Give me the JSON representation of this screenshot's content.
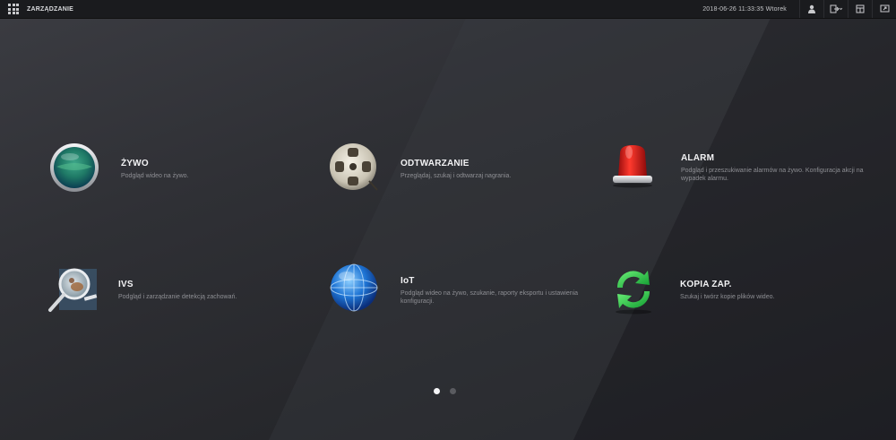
{
  "topbar": {
    "title": "ZARZĄDZANIE",
    "datetime": "2018-06-26 11:33:35 Wtorek",
    "icons": [
      "user-icon",
      "logout-icon",
      "window-icon",
      "fullscreen-icon"
    ]
  },
  "tiles": [
    {
      "title": "ŻYWO",
      "desc": "Podgląd wideo na żywo.",
      "icon": "live-view-icon"
    },
    {
      "title": "ODTWARZANIE",
      "desc": "Przeglądaj, szukaj i odtwarzaj nagrania.",
      "icon": "film-reel-icon"
    },
    {
      "title": "ALARM",
      "desc": "Podgląd i przeszukiwanie alarmów na żywo. Konfiguracja akcji na wypadek alarmu.",
      "icon": "alarm-siren-icon"
    },
    {
      "title": "IVS",
      "desc": "Podgląd i zarządzanie detekcją zachowań.",
      "icon": "magnifier-icon"
    },
    {
      "title": "IoT",
      "desc": "Podgląd wideo na żywo, szukanie, raporty eksportu i ustawienia konfiguracji.",
      "icon": "globe-icon"
    },
    {
      "title": "KOPIA ZAP.",
      "desc": "Szukaj i twórz kopie plików wideo.",
      "icon": "backup-sync-icon"
    }
  ],
  "pagination": {
    "pages": 2,
    "current": 1
  },
  "colors": {
    "background": "#2a2b30",
    "topbar": "#1a1b1e",
    "title_text": "#f2f2f4",
    "desc_text": "#8e8f94",
    "dot_active": "#f4f4f6",
    "dot_inactive": "#5a5b60"
  }
}
